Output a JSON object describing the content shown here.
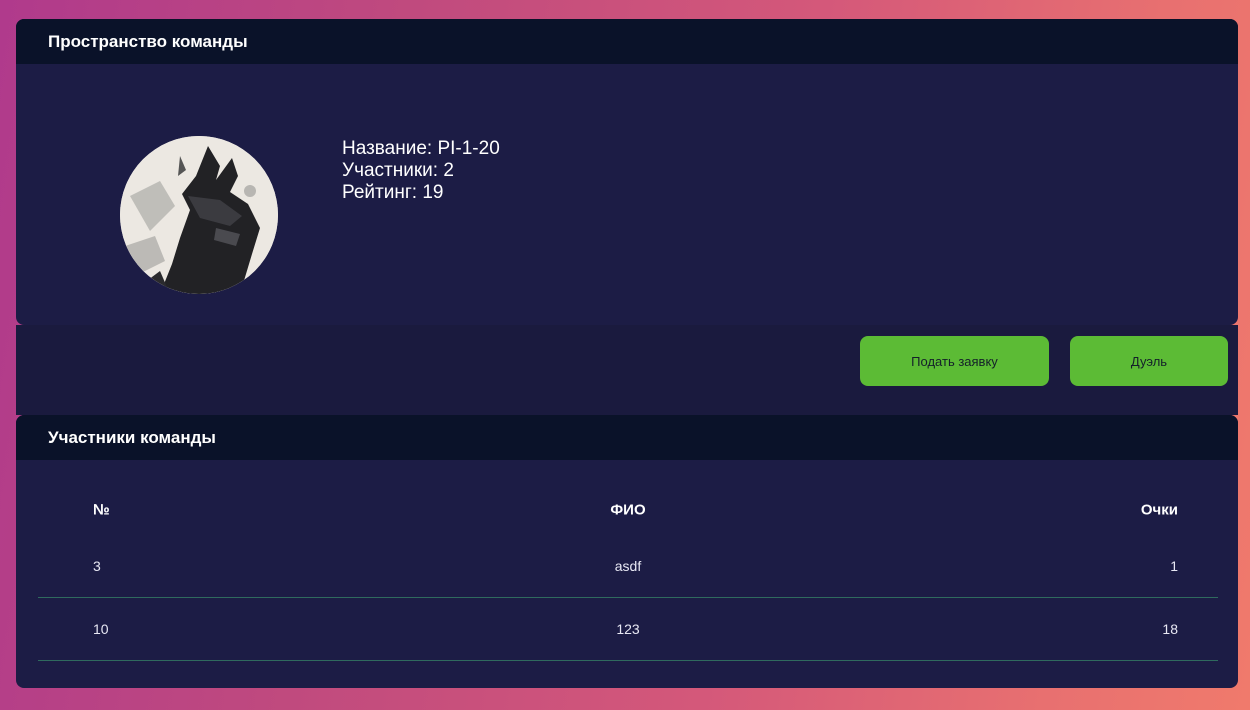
{
  "team_panel": {
    "title": "Пространство команды",
    "info": {
      "name_line": "Название: PI-1-20",
      "members_line": "Участники: 2",
      "rating_line": "Рейтинг: 19"
    }
  },
  "actions": {
    "apply_label": "Подать заявку",
    "duel_label": "Дуэль"
  },
  "members_panel": {
    "title": "Участники команды",
    "columns": [
      "№",
      "ФИО",
      "Очки"
    ],
    "rows": [
      {
        "num": "3",
        "name": "asdf",
        "points": "1"
      },
      {
        "num": "10",
        "name": "123",
        "points": "18"
      }
    ]
  },
  "colors": {
    "accent": "#5cbb35",
    "header_bg": "#0a1229",
    "panel_bg": "#1c1c45"
  }
}
